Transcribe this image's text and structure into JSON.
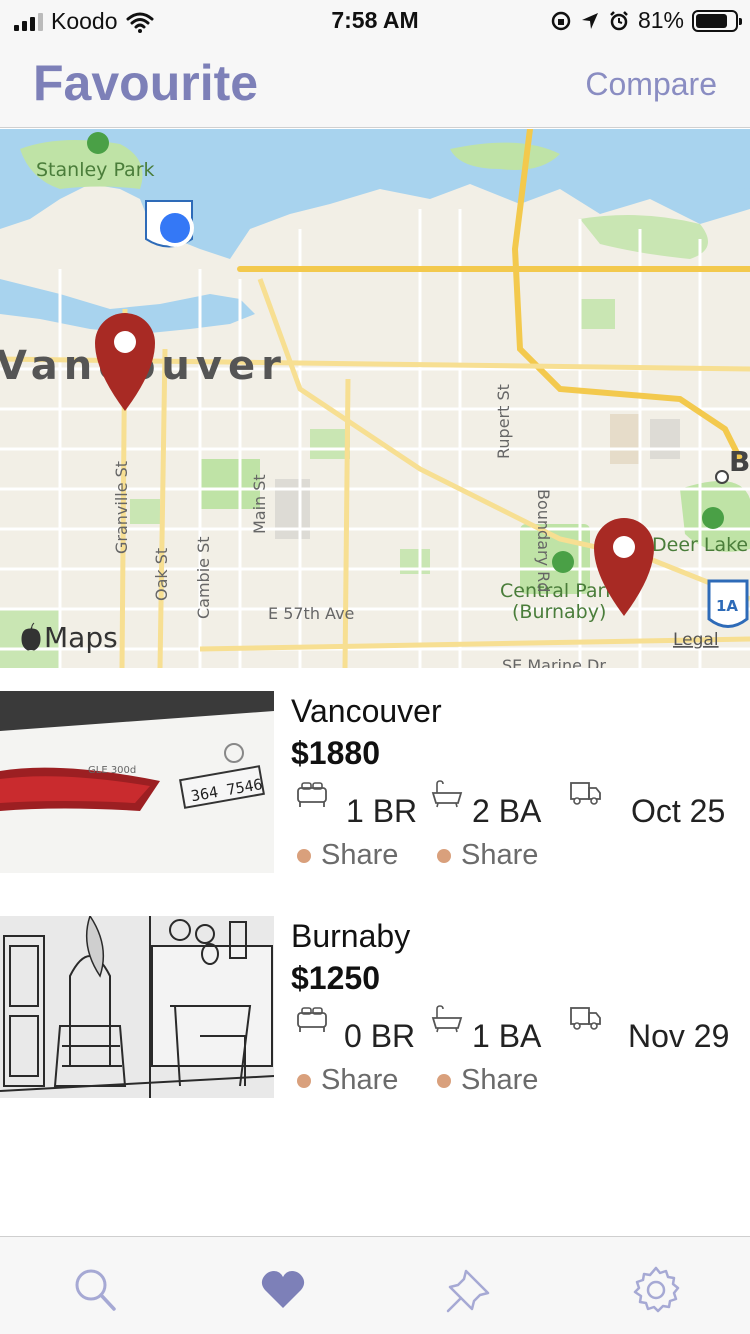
{
  "status_bar": {
    "carrier": "Koodo",
    "time": "7:58 AM",
    "battery": "81%"
  },
  "header": {
    "title": "Favourite",
    "compare_label": "Compare"
  },
  "map": {
    "labels": {
      "stanley_park": "Stanley Park",
      "vancouver": "Vancouver",
      "granville_st": "Granville St",
      "oak_st": "Oak St",
      "cambie_st": "Cambie St",
      "main_st": "Main St",
      "rupert_st": "Rupert St",
      "boundary_rd": "Boundary Rd",
      "e57th": "E 57th Ave",
      "central_park_1": "Central Park",
      "central_park_2": "(Burnaby)",
      "deer_lake": "Deer Lake P",
      "b_label": "B",
      "se_marine": "SE Marine Dr",
      "hwy_1a": "1A",
      "apple_maps": "Maps",
      "legal": "Legal"
    }
  },
  "listings": [
    {
      "city": "Vancouver",
      "price": "$1880",
      "bedrooms": "1 BR",
      "bathrooms": "2 BA",
      "move_date": "Oct 25",
      "share_1": "Share",
      "share_2": "Share",
      "thumb": {
        "plate": "364 7546",
        "badge": "GLE 300d"
      }
    },
    {
      "city": "Burnaby",
      "price": "$1250",
      "bedrooms": "0 BR",
      "bathrooms": "1 BA",
      "move_date": "Nov 29",
      "share_1": "Share",
      "share_2": "Share"
    }
  ],
  "tab_bar": {
    "tabs": [
      {
        "icon": "search-icon"
      },
      {
        "icon": "heart-icon",
        "active": true
      },
      {
        "icon": "pin-icon"
      },
      {
        "icon": "gear-icon"
      }
    ]
  },
  "colors": {
    "accent": "#7d80b8",
    "accent_inactive": "#a6a9d4",
    "share_dot": "#d9a07c",
    "map_pin": "#a82a24",
    "water": "#a8d3ee",
    "park": "#bfe3a6",
    "road_major": "#f3c94d"
  }
}
